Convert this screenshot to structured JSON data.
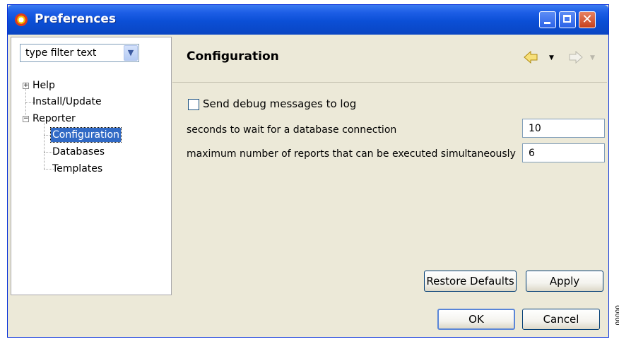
{
  "window": {
    "title": "Preferences"
  },
  "filter": {
    "placeholder": "type filter text"
  },
  "tree": {
    "items": [
      {
        "label": "Help"
      },
      {
        "label": "Install/Update"
      },
      {
        "label": "Reporter"
      },
      {
        "label": "Configuration"
      },
      {
        "label": "Databases"
      },
      {
        "label": "Templates"
      }
    ]
  },
  "page": {
    "title": "Configuration",
    "debug_checkbox": {
      "label": "Send debug messages to log",
      "checked": false
    },
    "wait_field": {
      "label": "seconds to wait for a database connection",
      "value": "10"
    },
    "max_reports_field": {
      "label": "maximum number of reports that can be executed simultaneously",
      "value": "6"
    },
    "restore_defaults_label": "Restore Defaults",
    "apply_label": "Apply"
  },
  "footer": {
    "ok_label": "OK",
    "cancel_label": "Cancel"
  },
  "side_number": "00000",
  "colors": {
    "titlebar": "#0b4fd6",
    "selection": "#316ac5",
    "dialog_bg": "#ece9d8"
  }
}
